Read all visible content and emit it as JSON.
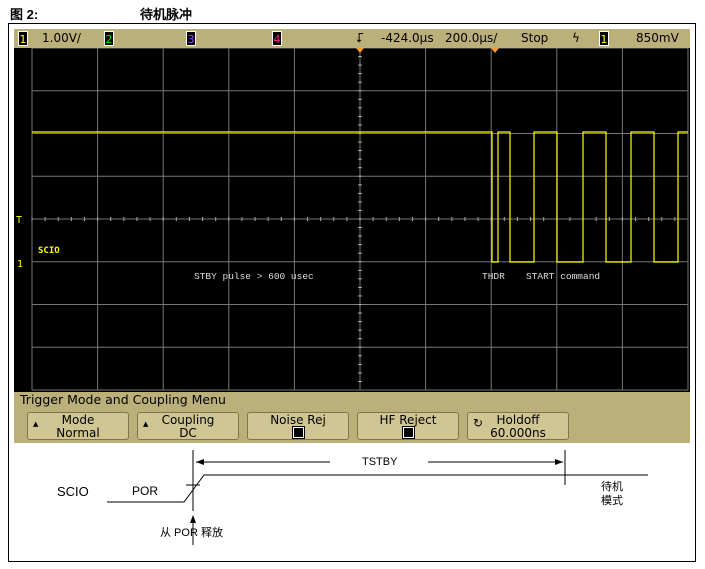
{
  "figure": {
    "label": "图 2:",
    "title": "待机脉冲"
  },
  "scope": {
    "status": {
      "ch1": "1",
      "ch1_scale": "1.00V/",
      "ch2": "2",
      "ch3": "3",
      "ch4": "4",
      "delay": "-424.0µs",
      "timebase": "200.0µs/",
      "run_state": "Stop",
      "trigger_source": "1",
      "trigger_level": "850mV"
    },
    "colors": {
      "ch1": "#ffff00",
      "ch2": "#00e000",
      "ch3": "#a040ff",
      "ch4": "#ff2080",
      "bezel": "#bcb07a"
    },
    "labels": {
      "signal": "SCIO",
      "stby": "STBY pulse > 600 usec",
      "thdr": "THDR",
      "start": "START command",
      "trigger_marker": "T",
      "ground_marker": "1"
    },
    "menu": {
      "title": "Trigger Mode and Coupling Menu",
      "buttons": [
        {
          "line1": "Mode",
          "line2": "Normal"
        },
        {
          "line1": "Coupling",
          "line2": "DC"
        },
        {
          "line1": "Noise Rej"
        },
        {
          "line1": "HF Reject"
        },
        {
          "line1": "Holdoff",
          "line2": "60.000ns"
        }
      ]
    }
  },
  "diagram": {
    "signal": "SCIO",
    "por": "POR",
    "tstby": "TSTBY",
    "standby_1": "待机",
    "standby_2": "模式",
    "release": "从 POR 释放"
  }
}
